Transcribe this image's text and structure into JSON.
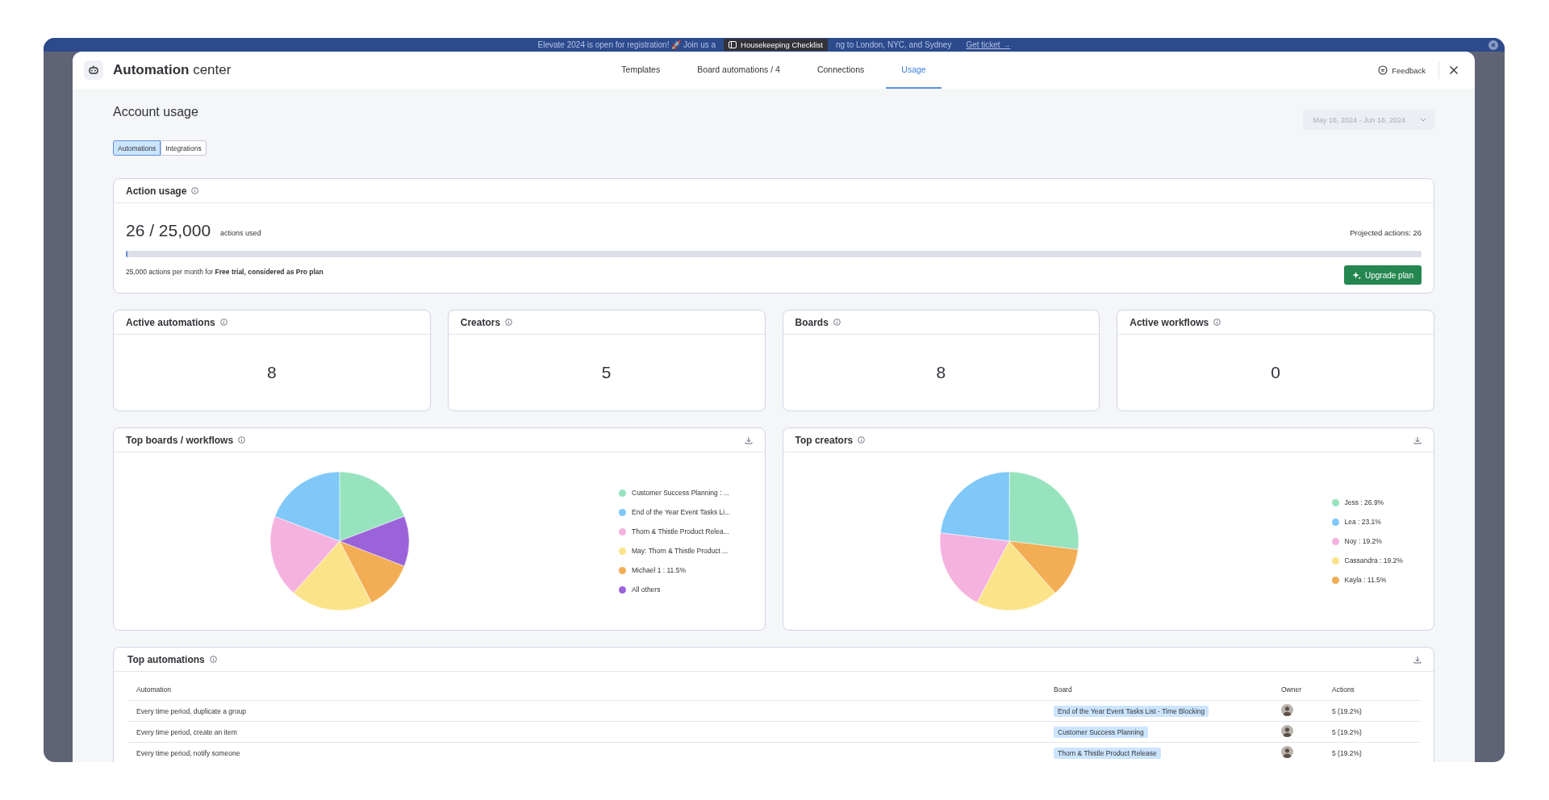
{
  "banner": {
    "texts": [
      "Elevate 2024 is open for registration! 🚀 Join us a",
      "ng to London, NYC, and Sydney"
    ],
    "link": "Get ticket →"
  },
  "tooltip": "Housekeeping Checklist",
  "header": {
    "title": "**Automation** center",
    "feedback": "Feedback",
    "tabs": [
      {
        "label": "Templates",
        "selected": false
      },
      {
        "label": "Board automations / 4",
        "selected": false
      },
      {
        "label": "Connections",
        "selected": false
      },
      {
        "label": "Usage",
        "selected": true
      }
    ]
  },
  "page": {
    "title": "Account usage",
    "date_range": "May 16, 2024 - Jun 16, 2024",
    "toggle": [
      {
        "label": "Automations",
        "selected": true
      },
      {
        "label": "Integrations",
        "selected": false
      }
    ]
  },
  "action_usage": {
    "title": "Action usage",
    "used": "26 / 25,000",
    "used_label": "actions used",
    "projected": "Projected actions: 26",
    "level": 0.00104,
    "note": "25,000 actions per month for **Free trial, considered as Pro plan**",
    "button": "Upgrade plan"
  },
  "stats": [
    {
      "title": "Active automations",
      "value": "8"
    },
    {
      "title": "Creators",
      "value": "5"
    },
    {
      "title": "Boards",
      "value": "8"
    },
    {
      "title": "Active workflows",
      "value": "0"
    }
  ],
  "charts": [
    {
      "title": "Top boards / workflows",
      "chart_data": {
        "type": "pie",
        "categories": [
          "Customer Success Planning : ...",
          "End of the Year Event Tasks Li...",
          "Thorn & Thistle Product Relea...",
          "May: Thorn & Thistle Product ...",
          "Michael 1 : 11.5%",
          "All others"
        ],
        "colors": [
          "#97e3be",
          "#7fc8f8",
          "#f5b2df",
          "#fbe38a",
          "#f2ad55",
          "#9b63d9"
        ],
        "values": [
          19.2,
          19.2,
          19.2,
          19.2,
          11.5,
          11.7
        ]
      }
    },
    {
      "title": "Top creators",
      "chart_data": {
        "type": "pie",
        "categories": [
          "Jess : 26.9%",
          "Lea : 23.1%",
          "Noy : 19.2%",
          "Cassandra : 19.2%",
          "Kayla : 11.5%"
        ],
        "colors": [
          "#97e3be",
          "#7fc8f8",
          "#f5b2df",
          "#fbe38a",
          "#f2ad55"
        ],
        "values": [
          26.9,
          23.1,
          19.2,
          19.2,
          11.5
        ]
      }
    }
  ],
  "top_automations": {
    "title": "Top automations",
    "columns": [
      "Automation",
      "Board",
      "Owner",
      "Actions"
    ],
    "rows": [
      {
        "automation": "Every time period, duplicate a group",
        "board": "End of the Year Event Tasks List - Time Blocking",
        "actions": "5 (19.2%)"
      },
      {
        "automation": "Every time period, create an item",
        "board": "Customer Success Planning",
        "actions": "5 (19.2%)"
      },
      {
        "automation": "Every time period, notify someone",
        "board": "Thorn & Thistle Product Release",
        "actions": "5 (19.2%)"
      }
    ]
  }
}
